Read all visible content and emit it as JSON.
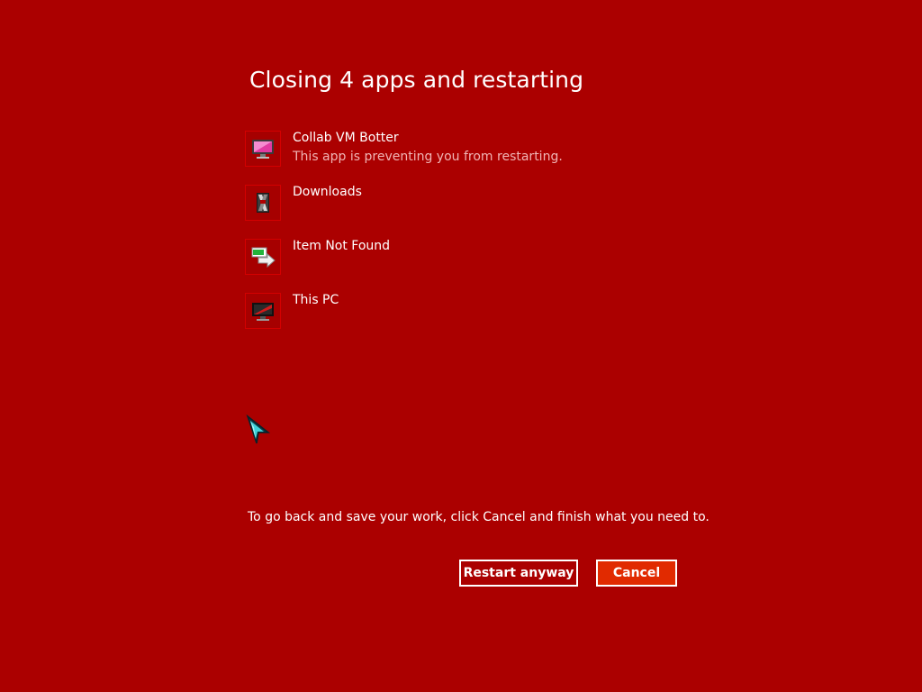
{
  "dialog": {
    "title": "Closing 4 apps and restarting"
  },
  "apps": [
    {
      "name": "Collab VM Botter",
      "note": "This app is preventing you from restarting.",
      "icon": "monitor-pink-icon"
    },
    {
      "name": "Downloads",
      "note": "",
      "icon": "downloads-folder-icon"
    },
    {
      "name": "Item Not Found",
      "note": "",
      "icon": "item-not-found-arrow-icon"
    },
    {
      "name": "This PC",
      "note": "",
      "icon": "this-pc-monitor-icon"
    }
  ],
  "footer": {
    "hint": "To go back and save your work, click Cancel and finish what you need to."
  },
  "buttons": {
    "restart_label": "Restart anyway",
    "cancel_label": "Cancel"
  },
  "colors": {
    "background": "#ab0000",
    "cancel_accent": "#e12a00",
    "note_text": "#f0b4b4"
  }
}
